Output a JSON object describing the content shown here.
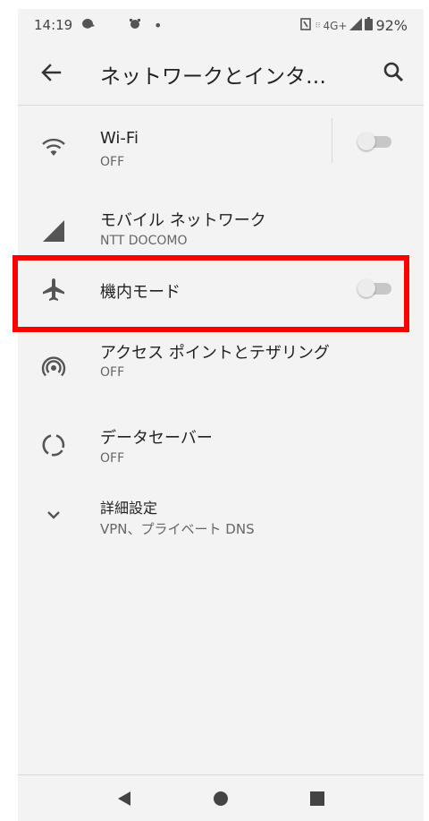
{
  "status_bar": {
    "time": "14:19",
    "network": "4G+",
    "battery": "92%"
  },
  "app_bar": {
    "title": "ネットワークとインタ…"
  },
  "settings": [
    {
      "title": "Wi-Fi",
      "subtitle": "OFF",
      "icon": "wifi-icon",
      "toggle": "off"
    },
    {
      "title": "モバイル ネットワーク",
      "subtitle": "NTT DOCOMO",
      "icon": "signal-icon"
    },
    {
      "title": "機内モード",
      "subtitle": "",
      "icon": "airplane-icon",
      "toggle": "off"
    },
    {
      "title": "アクセス ポイントとテザリング",
      "subtitle": "OFF",
      "icon": "hotspot-icon"
    },
    {
      "title": "データセーバー",
      "subtitle": "OFF",
      "icon": "data-saver-icon"
    },
    {
      "title": "詳細設定",
      "subtitle": "VPN、プライベート DNS",
      "icon": "chevron-down-icon"
    }
  ],
  "colors": {
    "highlight": "#ff0000",
    "background": "#f3f3f3"
  }
}
